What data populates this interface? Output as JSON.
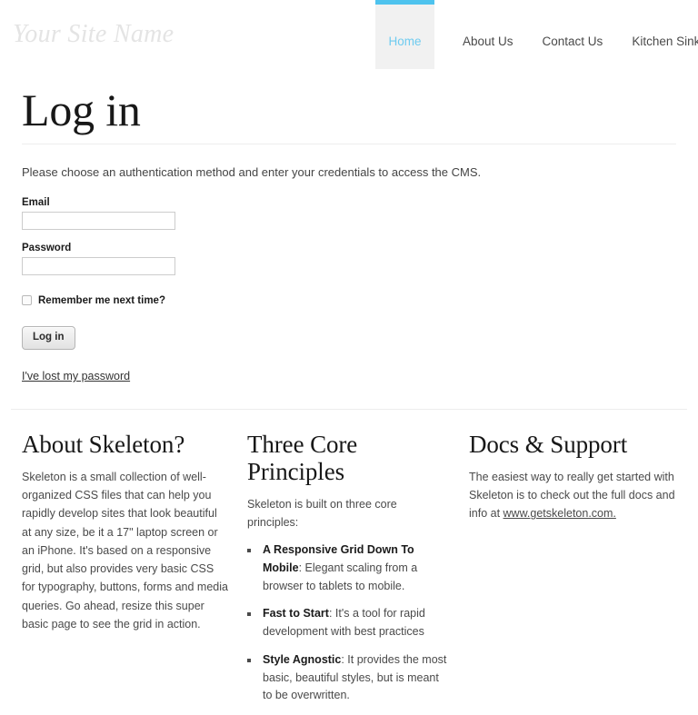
{
  "header": {
    "site_name": "Your Site Name",
    "nav": [
      {
        "label": "Home",
        "active": true
      },
      {
        "label": "About Us",
        "active": false
      },
      {
        "label": "Contact Us",
        "active": false
      },
      {
        "label": "Kitchen Sink",
        "active": false
      }
    ],
    "accent_color": "#4ec3ee",
    "active_tab_bg": "#f1f1f1"
  },
  "page": {
    "title": "Log in",
    "intro": "Please choose an authentication method and enter your credentials to access the CMS."
  },
  "form": {
    "email_label": "Email",
    "email_value": "",
    "email_placeholder": "",
    "password_label": "Password",
    "password_value": "",
    "password_placeholder": "",
    "remember_label": "Remember me next time?",
    "remember_checked": false,
    "submit_label": "Log in",
    "lost_password_label": "I've lost my password"
  },
  "columns": {
    "about": {
      "title": "About Skeleton?",
      "body": "Skeleton is a small collection of well-organized CSS files that can help you rapidly develop sites that look beautiful at any size, be it a 17\" laptop screen or an iPhone. It's based on a responsive grid, but also provides very basic CSS for typography, buttons, forms and media queries. Go ahead, resize this super basic page to see the grid in action."
    },
    "principles": {
      "title": "Three Core Principles",
      "intro": "Skeleton is built on three core principles:",
      "items": [
        {
          "lead": "A Responsive Grid Down To Mobile",
          "text": ": Elegant scaling from a browser to tablets to mobile."
        },
        {
          "lead": "Fast to Start",
          "text": ": It's a tool for rapid development with best practices"
        },
        {
          "lead": "Style Agnostic",
          "text": ": It provides the most basic, beautiful styles, but is meant to be overwritten."
        }
      ]
    },
    "docs": {
      "title": "Docs & Support",
      "body_before": "The easiest way to really get started with Skeleton is to check out the full docs and info at ",
      "link_label": "www.getskeleton.com."
    }
  }
}
